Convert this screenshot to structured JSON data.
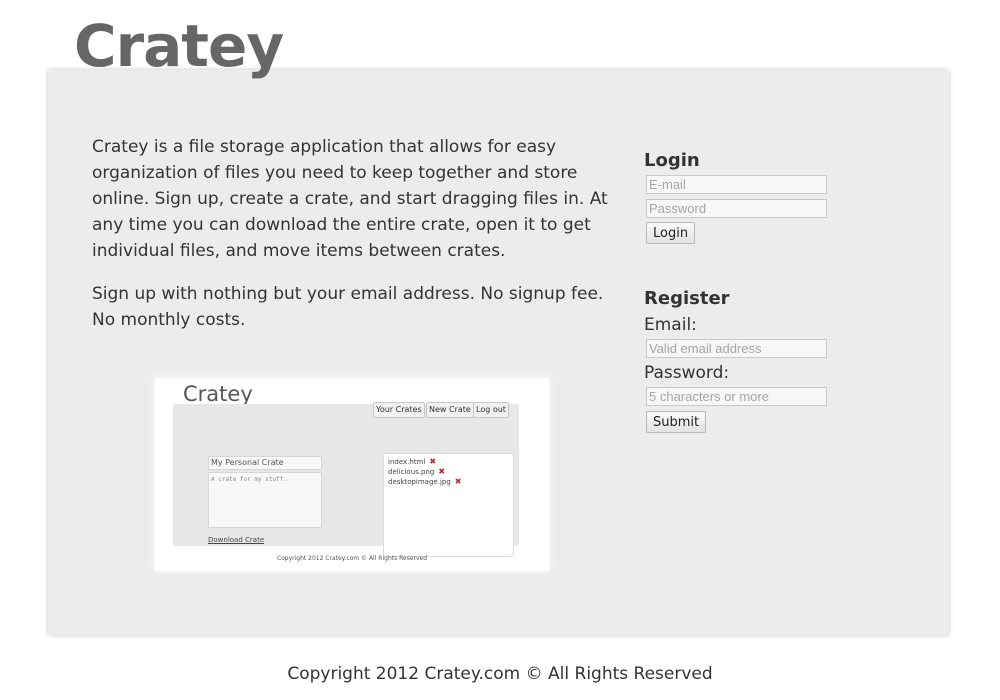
{
  "header": {
    "title": "Cratey"
  },
  "intro": {
    "paragraph1": "Cratey is a file storage application that allows for easy organization of files you need to keep together and store online. Sign up, create a crate, and start dragging files in. At any time you can download the entire crate, open it to get individual files, and move items between crates.",
    "paragraph2": "Sign up with nothing but your email address. No signup fee. No monthly costs."
  },
  "preview": {
    "title": "Cratey",
    "nav": [
      "Your Crates",
      "New Crate",
      "Log out"
    ],
    "crate_name": "My Personal Crate",
    "crate_description": "A crate for my stuff.",
    "download_label": "Download Crate",
    "files": [
      "index.html",
      "delicious.png",
      "desktopimage.jpg"
    ],
    "delete_glyph": "✖",
    "copyright": "Copyright 2012 Cratey.com © All Rights Reserved"
  },
  "login": {
    "heading": "Login",
    "email_placeholder": "E-mail",
    "password_placeholder": "Password",
    "button": "Login"
  },
  "register": {
    "heading": "Register",
    "email_label": "Email:",
    "email_placeholder": "Valid email address",
    "password_label": "Password:",
    "password_placeholder": "5 characters or more",
    "button": "Submit"
  },
  "footer": {
    "copyright": "Copyright 2012 Cratey.com © All Rights Reserved"
  },
  "colors": {
    "panel": "#ececec",
    "title": "#666666",
    "text": "#333333",
    "delete": "#c8252a"
  }
}
